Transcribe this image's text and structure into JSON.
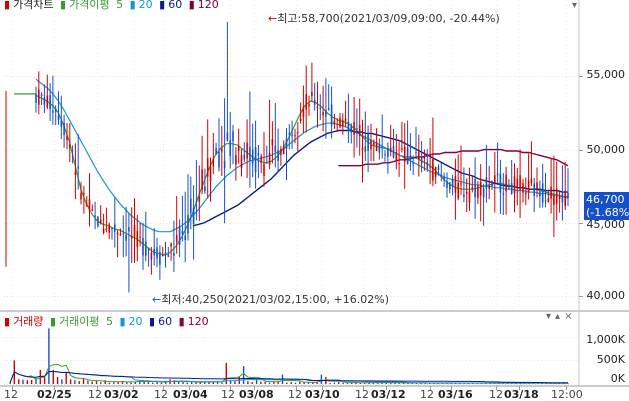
{
  "price_legend": {
    "title": "가격차트",
    "ma_label": "가격이평",
    "ma_periods": [
      "5",
      "20",
      "60",
      "120"
    ]
  },
  "volume_legend": {
    "title": "거래량",
    "ma_label": "거래이평",
    "ma_periods": [
      "5",
      "20",
      "60",
      "120"
    ]
  },
  "annotations": {
    "high": "최고:58,700(2021/03/09,09:00, -20.44%)",
    "low": "최저:40,250(2021/03/02,15:00, +16.02%)"
  },
  "current_price": {
    "price": "46,700",
    "change": "(-1.68%",
    "badge_color": "#1650c8"
  },
  "colors": {
    "up": "#d40000",
    "down": "#1650c8",
    "ma5": "#3a9a32",
    "ma20": "#1496d4",
    "ma60": "#0a1a8c",
    "ma120": "#800040"
  },
  "panel_controls": [
    "▾",
    "▴",
    "×"
  ],
  "chart_data": [
    {
      "type": "candlestick",
      "title": "가격차트",
      "y_ticks": [
        "55,000",
        "50,000",
        "45,000",
        "40,000"
      ],
      "y_tick_values": [
        55000,
        50000,
        45000,
        40000
      ],
      "ylim": [
        39400,
        60200
      ],
      "x_tick_labels": [
        "12",
        "02/25",
        "12",
        "03/02",
        "12",
        "03/04",
        "12",
        "03/08",
        "12",
        "03/10",
        "12",
        "03/12",
        "12",
        "03/16",
        "12",
        "03/18",
        "12:00"
      ],
      "x_tick_positions": [
        12,
        25,
        42,
        54,
        71,
        82,
        98,
        112,
        125,
        138,
        152,
        163,
        178,
        190,
        205,
        220,
        237
      ],
      "high": 58700,
      "low": 40250,
      "last": 46700,
      "series": [
        {
          "name": "5",
          "values": [
            53700,
            53500,
            53300,
            53000,
            52500,
            51600,
            50500,
            48900,
            47300,
            46300,
            45600,
            45100,
            44900,
            44800,
            44600,
            44500,
            44300,
            44100,
            43900,
            43600,
            43300,
            43000,
            42900,
            42800,
            43000,
            43400,
            44000,
            44800,
            45700,
            46800,
            47800,
            48800,
            49600,
            50100,
            50400,
            50400,
            50300,
            50000,
            49700,
            49400,
            49200,
            49100,
            49200,
            49500,
            50000,
            50700,
            51500,
            52300,
            53000,
            53300,
            53200,
            52900,
            52500,
            52200,
            52000,
            51900,
            51700,
            51400,
            51000,
            50600,
            50300,
            50200,
            50100,
            50000,
            49800,
            49600,
            49500,
            49500,
            49400,
            49200,
            49000,
            48700,
            48300,
            47900,
            47600,
            47400,
            47300,
            47300,
            47300,
            47400,
            47500,
            47600,
            47700,
            47700,
            47600,
            47500,
            47400,
            47400,
            47300,
            47300,
            47200,
            47100,
            47000,
            46900,
            46800,
            46700
          ]
        },
        {
          "name": "20",
          "values": [
            54800,
            54500,
            54200,
            53800,
            53300,
            52700,
            52000,
            51300,
            50600,
            49900,
            49200,
            48500,
            47900,
            47300,
            46800,
            46300,
            45900,
            45500,
            45200,
            44900,
            44700,
            44500,
            44400,
            44400,
            44400,
            44600,
            44800,
            45100,
            45500,
            45900,
            46400,
            46900,
            47400,
            47800,
            48200,
            48500,
            48800,
            49000,
            49200,
            49300,
            49400,
            49500,
            49600,
            49800,
            50000,
            50300,
            50600,
            50900,
            51200,
            51400,
            51600,
            51700,
            51800,
            51800,
            51700,
            51600,
            51400,
            51200,
            51000,
            50800,
            50600,
            50400,
            50200,
            50000,
            49800,
            49600,
            49400,
            49200,
            49000,
            48800,
            48600,
            48400,
            48300,
            48100,
            48000,
            47900,
            47800,
            47700,
            47600,
            47600,
            47500,
            47500,
            47400,
            47400,
            47300,
            47300,
            47200,
            47200,
            47100,
            47100,
            47000,
            47000,
            46900,
            46900,
            46800,
            46800
          ]
        },
        {
          "name": "60",
          "values": [
            null,
            null,
            null,
            null,
            null,
            null,
            null,
            null,
            null,
            null,
            null,
            null,
            null,
            null,
            null,
            null,
            null,
            null,
            null,
            null,
            null,
            null,
            null,
            null,
            null,
            null,
            null,
            null,
            44800,
            44900,
            45000,
            45200,
            45400,
            45600,
            45800,
            46000,
            46200,
            46500,
            46800,
            47100,
            47400,
            47700,
            48000,
            48400,
            48800,
            49200,
            49600,
            49900,
            50200,
            50500,
            50700,
            50900,
            51100,
            51200,
            51300,
            51300,
            51300,
            51200,
            51200,
            51100,
            51100,
            51000,
            50900,
            50800,
            50700,
            50600,
            50400,
            50200,
            50000,
            49800,
            49600,
            49400,
            49200,
            49000,
            48800,
            48600,
            48400,
            48300,
            48200,
            48000,
            47900,
            47800,
            47700,
            47600,
            47500,
            47500,
            47400,
            47400,
            47300,
            47300,
            47300,
            47200,
            47200,
            47200,
            47100,
            47100
          ]
        },
        {
          "name": "120",
          "values": [
            null,
            null,
            null,
            null,
            null,
            null,
            null,
            null,
            null,
            null,
            null,
            null,
            null,
            null,
            null,
            null,
            null,
            null,
            null,
            null,
            null,
            null,
            null,
            null,
            null,
            null,
            null,
            null,
            null,
            null,
            null,
            null,
            null,
            null,
            null,
            null,
            null,
            null,
            null,
            null,
            null,
            null,
            null,
            null,
            null,
            null,
            null,
            null,
            null,
            null,
            null,
            null,
            null,
            null,
            48900,
            48900,
            48900,
            48900,
            48900,
            49000,
            49000,
            49000,
            49100,
            49100,
            49200,
            49300,
            49300,
            49400,
            49500,
            49500,
            49600,
            49700,
            49700,
            49800,
            49800,
            49800,
            49900,
            49900,
            49900,
            49900,
            50000,
            50000,
            50000,
            50000,
            49900,
            49900,
            49900,
            49800,
            49800,
            49700,
            49600,
            49500,
            49400,
            49300,
            49100,
            48900
          ]
        }
      ]
    },
    {
      "type": "bar",
      "title": "거래량",
      "y_ticks": [
        "1,000K",
        "500K",
        "0K"
      ],
      "y_tick_values": [
        1000,
        500,
        0
      ],
      "ylim": [
        0,
        1400
      ],
      "unit": "K",
      "values": [
        20,
        500,
        100,
        90,
        80,
        90,
        120,
        300,
        150,
        1180,
        300,
        150,
        100,
        250,
        100,
        80,
        60,
        120,
        70,
        50,
        60,
        40,
        80,
        30,
        40,
        50,
        60,
        40,
        30,
        50,
        80,
        60,
        40,
        30,
        60,
        30,
        40,
        100,
        80,
        60,
        40,
        30,
        50,
        40,
        30,
        60,
        40,
        50,
        40,
        30,
        450,
        80,
        60,
        150,
        380,
        60,
        40,
        90,
        50,
        40,
        30,
        40,
        60,
        200,
        30,
        40,
        30,
        50,
        40,
        30,
        40,
        30,
        200,
        150,
        20,
        30,
        40,
        30,
        20,
        30,
        25,
        30,
        20,
        25,
        30,
        20,
        30,
        25,
        20,
        30,
        20,
        25,
        20,
        30,
        20,
        25,
        20,
        15,
        20,
        25,
        20,
        15,
        20,
        15,
        25,
        20,
        15,
        20,
        15,
        20,
        25,
        20,
        15,
        20,
        30,
        20,
        15,
        20,
        15,
        20,
        25,
        15,
        20,
        15,
        20,
        15,
        20,
        15,
        20,
        15
      ]
    }
  ]
}
